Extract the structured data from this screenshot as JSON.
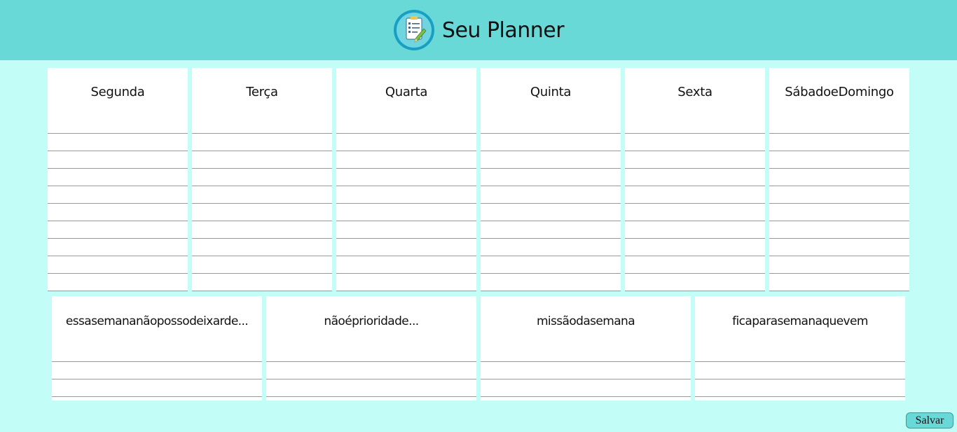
{
  "header": {
    "title": "Seu Planner",
    "logo_icon": "clipboard-checklist-icon"
  },
  "days": [
    {
      "label": "Segunda"
    },
    {
      "label": "Terça"
    },
    {
      "label": "Quarta"
    },
    {
      "label": "Quinta"
    },
    {
      "label": "Sexta"
    },
    {
      "label": "SábadoeDomingo"
    }
  ],
  "day_lines": 9,
  "notes": [
    {
      "label": "essasemananãopossodeixarde..."
    },
    {
      "label": "nãoéprioridade..."
    },
    {
      "label": "missãodasemana"
    },
    {
      "label": "ficaparasemanaquevem"
    }
  ],
  "note_lines": 2,
  "actions": {
    "save_label": "Salvar"
  },
  "colors": {
    "header_bg": "#69d9d8",
    "page_bg": "#c2fdf7",
    "card_bg": "#ffffff",
    "line": "#9a9a9a"
  }
}
